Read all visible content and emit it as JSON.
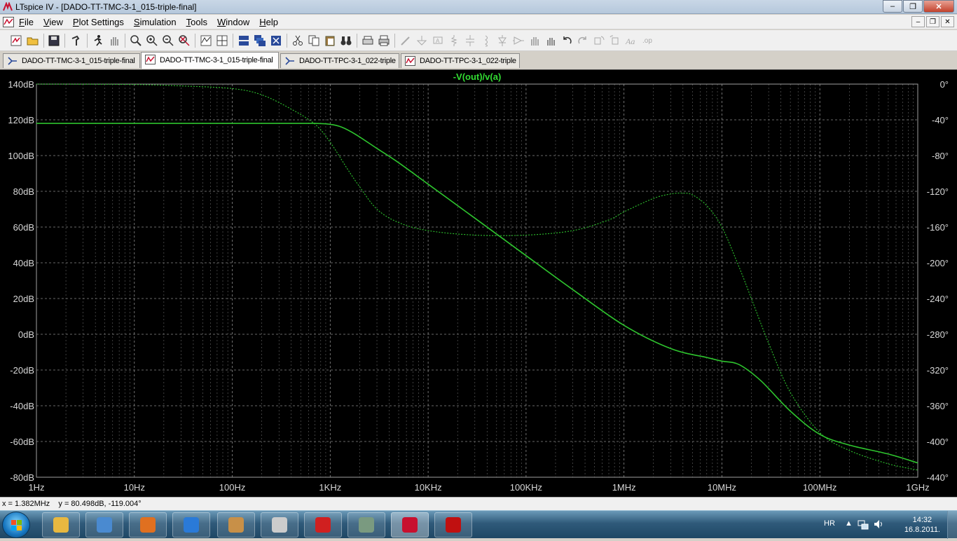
{
  "window": {
    "app_name": "LTspice IV",
    "title": "LTspice IV - [DADO-TT-TMC-3-1_015-triple-final]"
  },
  "menubar": {
    "items": [
      {
        "label": "File",
        "key": "F"
      },
      {
        "label": "View",
        "key": "V"
      },
      {
        "label": "Plot Settings",
        "key": "P"
      },
      {
        "label": "Simulation",
        "key": "S"
      },
      {
        "label": "Tools",
        "key": "T"
      },
      {
        "label": "Window",
        "key": "W"
      },
      {
        "label": "Help",
        "key": "H"
      }
    ]
  },
  "tabs": [
    {
      "label": "DADO-TT-TMC-3-1_015-triple-final",
      "icon": "schematic-icon",
      "active": false
    },
    {
      "label": "DADO-TT-TMC-3-1_015-triple-final",
      "icon": "waveform-icon",
      "active": true
    },
    {
      "label": "DADO-TT-TPC-3-1_022-triple",
      "icon": "schematic-icon",
      "active": false
    },
    {
      "label": "DADO-TT-TPC-3-1_022-triple",
      "icon": "waveform-icon",
      "active": false
    }
  ],
  "colors": {
    "trace": "#2ec42e",
    "grid": "#8a8a8a",
    "axis_text": "#d8d8d8",
    "background": "#000000",
    "trace_label": "#33dd33"
  },
  "chart_data": {
    "type": "line",
    "title": "-V(out)/v(a)",
    "x_scale": "log",
    "xlim": [
      1,
      1000000000
    ],
    "ylim_left": [
      -80,
      140
    ],
    "ylim_right": [
      -440,
      0
    ],
    "x_ticks": [
      {
        "v": 1,
        "label": "1Hz"
      },
      {
        "v": 10,
        "label": "10Hz"
      },
      {
        "v": 100,
        "label": "100Hz"
      },
      {
        "v": 1000,
        "label": "1KHz"
      },
      {
        "v": 10000,
        "label": "10KHz"
      },
      {
        "v": 100000,
        "label": "100KHz"
      },
      {
        "v": 1000000,
        "label": "1MHz"
      },
      {
        "v": 10000000,
        "label": "10MHz"
      },
      {
        "v": 100000000,
        "label": "100MHz"
      },
      {
        "v": 1000000000,
        "label": "1GHz"
      }
    ],
    "y_ticks_left": [
      {
        "v": 140,
        "label": "140dB"
      },
      {
        "v": 120,
        "label": "120dB"
      },
      {
        "v": 100,
        "label": "100dB"
      },
      {
        "v": 80,
        "label": "80dB"
      },
      {
        "v": 60,
        "label": "60dB"
      },
      {
        "v": 40,
        "label": "40dB"
      },
      {
        "v": 20,
        "label": "20dB"
      },
      {
        "v": 0,
        "label": "0dB"
      },
      {
        "v": -20,
        "label": "-20dB"
      },
      {
        "v": -40,
        "label": "-40dB"
      },
      {
        "v": -60,
        "label": "-60dB"
      },
      {
        "v": -80,
        "label": "-80dB"
      }
    ],
    "y_ticks_right": [
      {
        "v": 0,
        "label": "0°"
      },
      {
        "v": -40,
        "label": "-40°"
      },
      {
        "v": -80,
        "label": "-80°"
      },
      {
        "v": -120,
        "label": "-120°"
      },
      {
        "v": -160,
        "label": "-160°"
      },
      {
        "v": -200,
        "label": "-200°"
      },
      {
        "v": -240,
        "label": "-240°"
      },
      {
        "v": -280,
        "label": "-280°"
      },
      {
        "v": -320,
        "label": "-320°"
      },
      {
        "v": -360,
        "label": "-360°"
      },
      {
        "v": -400,
        "label": "-400°"
      },
      {
        "v": -440,
        "label": "-440°"
      }
    ],
    "grid": true,
    "series": [
      {
        "quantity": "magnitude",
        "style": "solid",
        "axis": "left",
        "points": [
          [
            1,
            118
          ],
          [
            10,
            118
          ],
          [
            100,
            118
          ],
          [
            400,
            118
          ],
          [
            700,
            118
          ],
          [
            1000,
            117.5
          ],
          [
            1300,
            116
          ],
          [
            1800,
            112
          ],
          [
            3000,
            104
          ],
          [
            5000,
            96
          ],
          [
            10000,
            84
          ],
          [
            30000,
            65
          ],
          [
            100000,
            44
          ],
          [
            300000,
            25
          ],
          [
            1000000,
            5
          ],
          [
            3000000,
            -8
          ],
          [
            7000000,
            -13
          ],
          [
            10000000,
            -15
          ],
          [
            15000000,
            -17
          ],
          [
            25000000,
            -26
          ],
          [
            50000000,
            -43
          ],
          [
            100000000,
            -56
          ],
          [
            200000000,
            -62
          ],
          [
            500000000,
            -67
          ],
          [
            1000000000,
            -72
          ]
        ]
      },
      {
        "quantity": "phase",
        "style": "dashed",
        "axis": "right",
        "points": [
          [
            1,
            0
          ],
          [
            10,
            -0.5
          ],
          [
            30,
            -2
          ],
          [
            100,
            -5
          ],
          [
            200,
            -12
          ],
          [
            400,
            -28
          ],
          [
            700,
            -45
          ],
          [
            1000,
            -65
          ],
          [
            1500,
            -95
          ],
          [
            2000,
            -115
          ],
          [
            3000,
            -140
          ],
          [
            5000,
            -155
          ],
          [
            10000,
            -164
          ],
          [
            30000,
            -169
          ],
          [
            100000,
            -169
          ],
          [
            300000,
            -164
          ],
          [
            700000,
            -152
          ],
          [
            1000000,
            -143
          ],
          [
            2000000,
            -128
          ],
          [
            3000000,
            -123
          ],
          [
            4000000,
            -122
          ],
          [
            5000000,
            -124
          ],
          [
            7000000,
            -136
          ],
          [
            10000000,
            -160
          ],
          [
            15000000,
            -205
          ],
          [
            20000000,
            -240
          ],
          [
            30000000,
            -290
          ],
          [
            50000000,
            -345
          ],
          [
            100000000,
            -390
          ],
          [
            200000000,
            -410
          ],
          [
            500000000,
            -425
          ],
          [
            1000000000,
            -432
          ]
        ]
      }
    ]
  },
  "status": {
    "cursor_readout": "x = 1.382MHz    y = 80.498dB, -119.004°"
  },
  "taskbar": {
    "apps": [
      {
        "icon": "explorer-folder-icon"
      },
      {
        "icon": "media-player-icon"
      },
      {
        "icon": "office-icon"
      },
      {
        "icon": "internet-explorer-icon"
      },
      {
        "icon": "picture-manager-icon"
      },
      {
        "icon": "network-tool-icon"
      },
      {
        "icon": "antivirus-icon"
      },
      {
        "icon": "oscilloscope-icon"
      },
      {
        "icon": "ltspice-icon",
        "active": true
      },
      {
        "icon": "acrobat-icon"
      }
    ],
    "language": "HR",
    "time": "14:32",
    "date": "16.8.2011."
  }
}
